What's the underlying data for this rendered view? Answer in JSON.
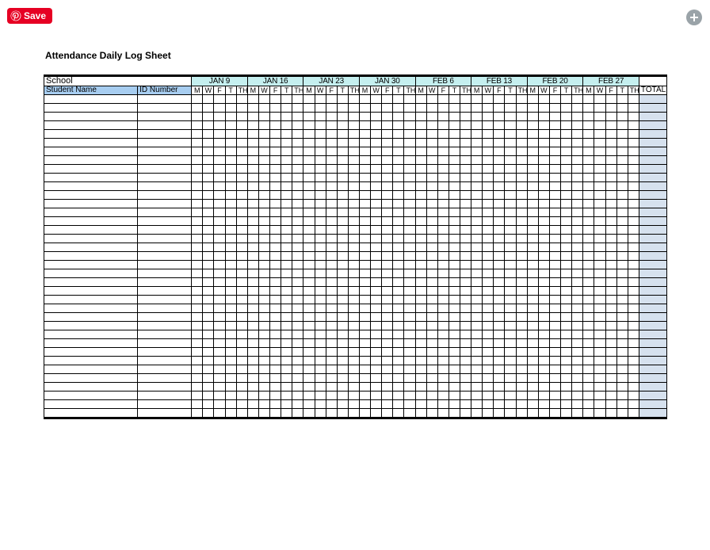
{
  "save_label": "Save",
  "title": "Attendance Daily Log Sheet",
  "headers": {
    "school": "School",
    "student_name": "Student Name",
    "id_number": "ID Number",
    "total": "TOTAL"
  },
  "weeks": [
    "JAN 9",
    "JAN 16",
    "JAN 23",
    "JAN 30",
    "FEB 6",
    "FEB 13",
    "FEB 20",
    "FEB 27"
  ],
  "days": [
    "M",
    "W",
    "F",
    "T",
    "TH"
  ],
  "row_count": 37
}
